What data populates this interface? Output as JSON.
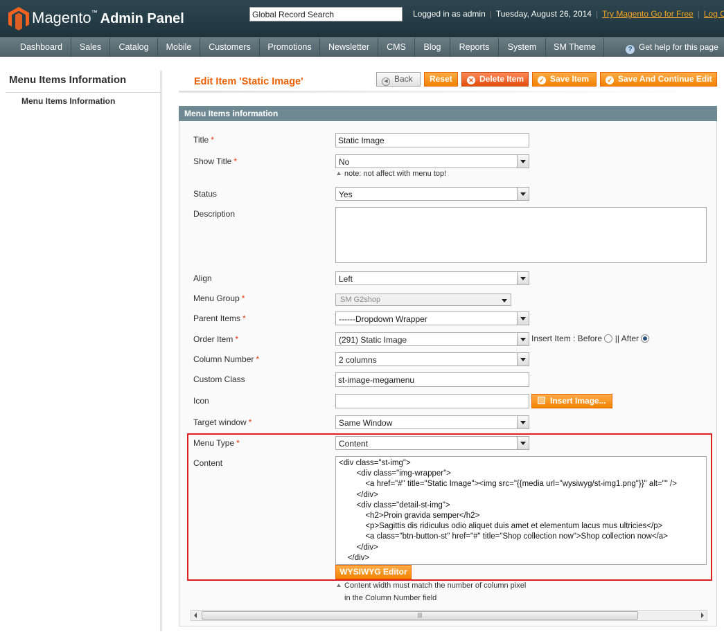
{
  "header": {
    "app_name": "Magento",
    "app_name_suffix": "Admin Panel",
    "search_placeholder": "Global Record Search",
    "logged_in": "Logged in as admin",
    "date": "Tuesday, August 26, 2014",
    "try_link": "Try Magento Go for Free",
    "logout_link": "Log Out"
  },
  "nav": {
    "items": [
      "Dashboard",
      "Sales",
      "Catalog",
      "Mobile",
      "Customers",
      "Promotions",
      "Newsletter",
      "CMS",
      "Blog",
      "Reports",
      "System",
      "SM Theme"
    ],
    "help": "Get help for this page"
  },
  "sidebar": {
    "title": "Menu Items Information",
    "items": [
      "Menu Items Information"
    ]
  },
  "page": {
    "title": "Edit Item 'Static Image'",
    "buttons": {
      "back": "Back",
      "reset": "Reset",
      "delete": "Delete Item",
      "save": "Save Item",
      "save_continue": "Save And Continue Edit"
    }
  },
  "form": {
    "section_title": "Menu Items information",
    "title_label": "Title",
    "title_value": "Static Image",
    "show_title_label": "Show Title",
    "show_title_value": "No",
    "show_title_note": "note: not affect with menu top!",
    "status_label": "Status",
    "status_value": "Yes",
    "description_label": "Description",
    "description_value": "",
    "align_label": "Align",
    "align_value": "Left",
    "menu_group_label": "Menu Group",
    "menu_group_value": "SM G2shop",
    "parent_items_label": "Parent Items",
    "parent_items_value": "------Dropdown Wrapper",
    "order_item_label": "Order Item",
    "order_item_value": "(291) Static Image",
    "insert_item_label": "Insert Item : Before",
    "insert_after_label": "|| After",
    "insert_selected": "After",
    "column_number_label": "Column Number",
    "column_number_value": "2 columns",
    "custom_class_label": "Custom Class",
    "custom_class_value": "st-image-megamenu",
    "icon_label": "Icon",
    "icon_value": "",
    "insert_image_button": "Insert Image...",
    "target_window_label": "Target window",
    "target_window_value": "Same Window",
    "menu_type_label": "Menu Type",
    "menu_type_value": "Content",
    "content_label": "Content",
    "content_value": "<div class=\"st-img\">\n\t\t<div class=\"img-wrapper\">\n\t\t\t<a href=\"#\" title=\"Static Image\"><img src=\"{{media url=\"wysiwyg/st-img1.png\"}}\" alt=\"\" />\n\t\t</div>\n\t\t<div class=\"detail-st-img\">\n\t\t\t<h2>Proin gravida semper</h2>\n\t\t\t<p>Sagittis dis ridiculus odio aliquet duis amet et elementum lacus mus ultricies</p>\n\t\t\t<a class=\"btn-button-st\" href=\"#\" title=\"Shop collection now\">Shop collection now</a>\n\t\t</div>\n\t</div>",
    "wysiwyg_button": "WYSIWYG Editor",
    "content_note_1": "Content width must match the number of column pixel",
    "content_note_2": "in the Column Number field",
    "required_mark": "*"
  },
  "colors": {
    "accent": "#f18200",
    "title_orange": "#eb5e00",
    "header_bg": "#2d4650",
    "highlight_border": "#e21f1f"
  }
}
